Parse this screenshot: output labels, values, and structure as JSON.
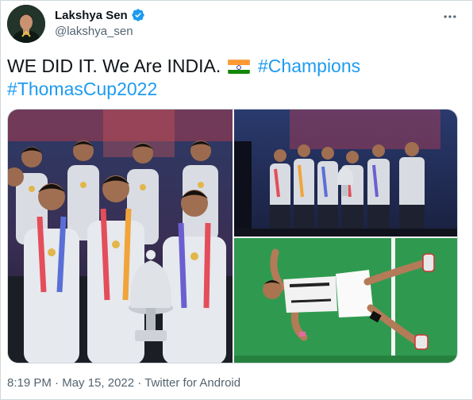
{
  "tweet": {
    "author_name": "Lakshya Sen",
    "author_handle": "@lakshya_sen",
    "text_main": "WE DID IT. We Are INDIA.",
    "hashtags": [
      "#Champions",
      "#ThomasCup2022"
    ],
    "time": "8:19 PM",
    "separator": "·",
    "date": "May 15, 2022",
    "client": "Twitter for Android"
  },
  "icons": {
    "verified": "verified-badge-icon",
    "more": "more-options-icon",
    "flag": "india-flag-emoji"
  },
  "colors": {
    "hashtag": "#1d9bf0",
    "verified": "#1d9bf0",
    "secondary_text": "#536471",
    "court_green": "#2f9a4f"
  }
}
